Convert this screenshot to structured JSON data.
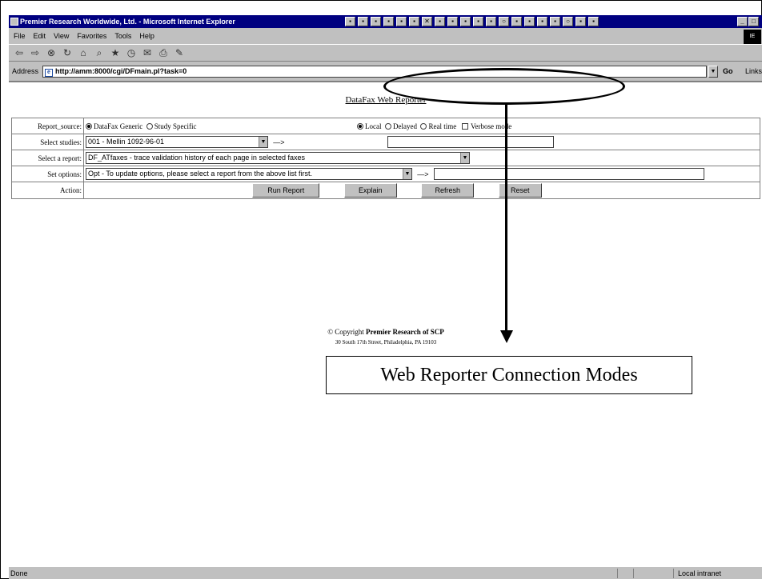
{
  "window": {
    "title": "Premier Research Worldwide, Ltd. - Microsoft Internet Explorer",
    "min_label": "_",
    "max_label": "□",
    "throbber_label": "IE"
  },
  "menu": [
    "File",
    "Edit",
    "View",
    "Favorites",
    "Tools",
    "Help"
  ],
  "toolbar_icons": [
    "back-icon",
    "forward-icon",
    "stop-icon",
    "refresh-icon",
    "home-icon",
    "search-icon",
    "favorites-icon",
    "history-icon",
    "mail-icon",
    "print-icon",
    "edit-icon"
  ],
  "address": {
    "label": "Address",
    "url": "http://amm:8000/cgi/DFmain.pl?task=0",
    "go_label": "Go",
    "links_label": "Links"
  },
  "page": {
    "title": "DataFax Web Reporter",
    "rows": {
      "report_source": {
        "label": "Report_source:",
        "option_generic": "DataFax Generic",
        "option_study": "Study Specific",
        "option_local": "Local",
        "option_delayed": "Delayed",
        "option_realtime": "Real time",
        "option_verbose": "Verbose mode"
      },
      "select_studies": {
        "label": "Select studies:",
        "value": "001 - Mellin 1092-96-01",
        "arrow": "—>"
      },
      "select_report": {
        "label": "Select a report:",
        "value": "DF_ATfaxes     - trace validation history of each page in selected faxes"
      },
      "set_options": {
        "label": "Set options:",
        "value": "Opt - To update options, please select a report from the above list first.",
        "arrow": "—>"
      },
      "action": {
        "label": "Action:",
        "run": "Run Report",
        "explain": "Explain",
        "refresh": "Refresh",
        "reset": "Reset"
      }
    },
    "copyright_prefix": "© Copyright",
    "copyright_org": "Premier Research of SCP",
    "copyright_address": "30 South 17th Street, Philadelphia, PA 19103"
  },
  "annotation": {
    "caption": "Web Reporter Connection Modes"
  },
  "status": {
    "left": "Done",
    "zone": "Local intranet"
  }
}
